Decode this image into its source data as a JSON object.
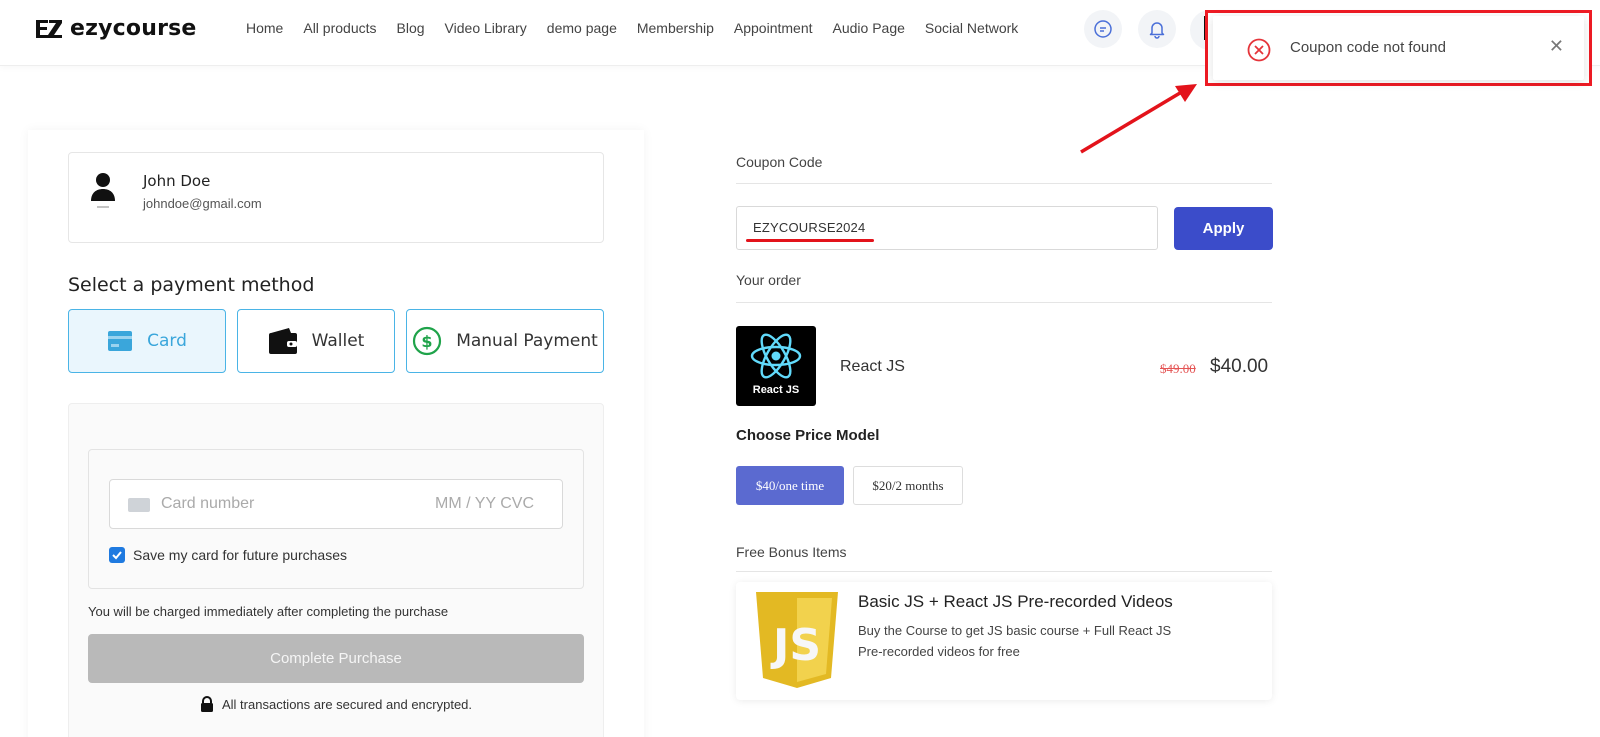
{
  "brand": {
    "logo_text": "ezycourse"
  },
  "nav": {
    "items": [
      "Home",
      "All products",
      "Blog",
      "Video Library",
      "demo page",
      "Membership",
      "Appointment",
      "Audio Page",
      "Social Network"
    ]
  },
  "toast": {
    "message": "Coupon code not found",
    "type": "error",
    "icon": "error-circle-icon",
    "close_icon": "close-icon"
  },
  "user": {
    "name": "John Doe",
    "email": "johndoe@gmail.com"
  },
  "payment": {
    "title": "Select a payment method",
    "methods": [
      {
        "label": "Card",
        "icon": "card-icon",
        "selected": true
      },
      {
        "label": "Wallet",
        "icon": "wallet-icon",
        "selected": false
      },
      {
        "label": "Manual Payment",
        "icon": "dollar-circle-icon",
        "selected": false
      }
    ],
    "card_placeholder": "Card number",
    "card_exp_placeholder": "MM / YY  CVC",
    "save_card_label": "Save my card for future purchases",
    "save_card_checked": true,
    "charge_note": "You will be charged immediately after completing the purchase",
    "complete_label": "Complete Purchase",
    "secure_note": "All transactions are secured and encrypted."
  },
  "coupon": {
    "label": "Coupon Code",
    "value": "EZYCOURSE2024",
    "apply_label": "Apply"
  },
  "order": {
    "label": "Your order",
    "product": {
      "name": "React JS",
      "thumb_label": "React JS",
      "old_price": "$49.00",
      "price": "$40.00"
    },
    "price_model_title": "Choose Price Model",
    "price_models": [
      {
        "label": "$40/one time",
        "selected": true
      },
      {
        "label": "$20/2 months",
        "selected": false
      }
    ]
  },
  "bonus": {
    "label": "Free Bonus Items",
    "title": "Basic JS + React JS Pre-recorded Videos",
    "description": "Buy the Course to get JS basic course + Full React JS Pre-recorded videos for free"
  },
  "colors": {
    "primary": "#3b4cca",
    "accent": "#4ab4e6",
    "error": "#ee1b24",
    "price_active": "#5b6ad0"
  }
}
